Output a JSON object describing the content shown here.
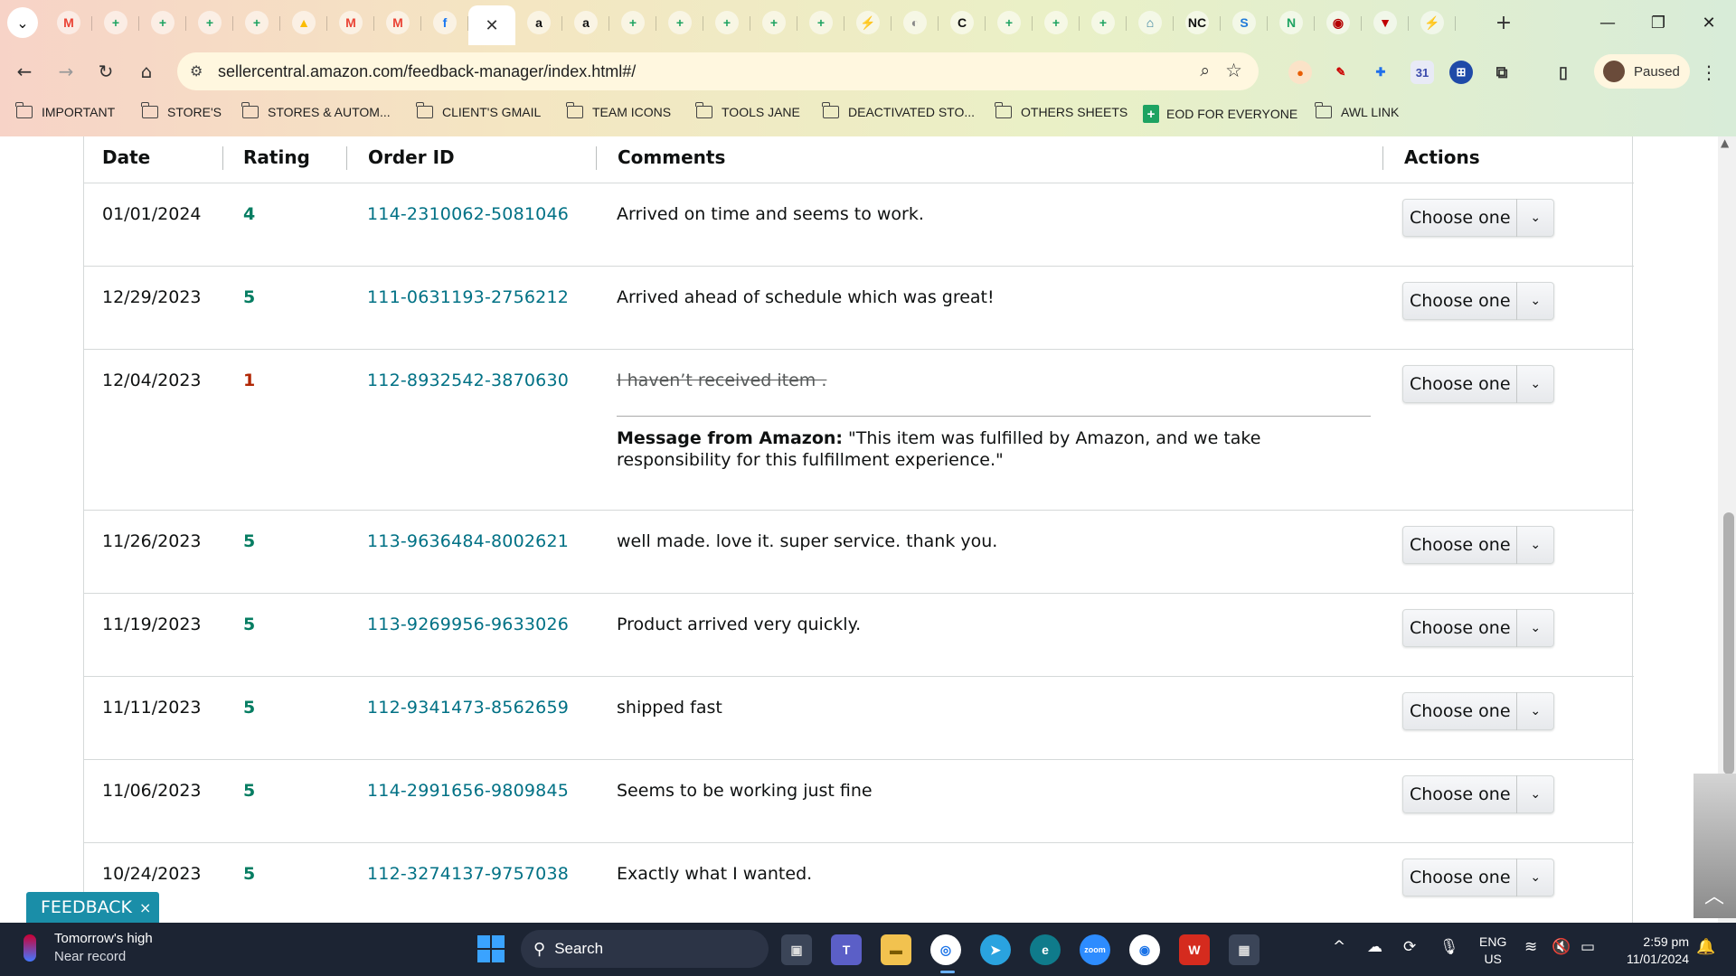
{
  "browser": {
    "url": "sellercentral.amazon.com/feedback-manager/index.html#/",
    "profile_label": "Paused",
    "tabs": [
      {
        "icon": "gmail-icon",
        "glyph": "M",
        "color": "#ea4335"
      },
      {
        "icon": "sheets-icon",
        "glyph": "+",
        "color": "#1ea362"
      },
      {
        "icon": "sheets-icon",
        "glyph": "+",
        "color": "#1ea362"
      },
      {
        "icon": "sheets-icon",
        "glyph": "+",
        "color": "#1ea362"
      },
      {
        "icon": "sheets-icon",
        "glyph": "+",
        "color": "#1ea362"
      },
      {
        "icon": "drive-icon",
        "glyph": "▲",
        "color": "#fbbc04"
      },
      {
        "icon": "gmail-icon",
        "glyph": "M",
        "color": "#ea4335"
      },
      {
        "icon": "gmail-icon",
        "glyph": "M",
        "color": "#ea4335"
      },
      {
        "icon": "facebook-icon",
        "glyph": "f",
        "color": "#1877f2"
      },
      {
        "icon": "close-icon",
        "glyph": "✕",
        "color": "#333333",
        "active": true
      },
      {
        "icon": "amazon-icon",
        "glyph": "a",
        "color": "#111111"
      },
      {
        "icon": "amazon-icon",
        "glyph": "a",
        "color": "#111111"
      },
      {
        "icon": "sheets-icon",
        "glyph": "+",
        "color": "#1ea362"
      },
      {
        "icon": "sheets-icon",
        "glyph": "+",
        "color": "#1ea362"
      },
      {
        "icon": "sheets-icon",
        "glyph": "+",
        "color": "#1ea362"
      },
      {
        "icon": "sheets-icon",
        "glyph": "+",
        "color": "#1ea362"
      },
      {
        "icon": "sheets-icon",
        "glyph": "+",
        "color": "#1ea362"
      },
      {
        "icon": "zapier-icon",
        "glyph": "⚡",
        "color": "#ff4f00"
      },
      {
        "icon": "globe-icon",
        "glyph": "◐",
        "color": "#888888"
      },
      {
        "icon": "c-icon",
        "glyph": "C",
        "color": "#111111"
      },
      {
        "icon": "sheets-icon",
        "glyph": "+",
        "color": "#1ea362"
      },
      {
        "icon": "sheets-icon",
        "glyph": "+",
        "color": "#1ea362"
      },
      {
        "icon": "sheets-icon",
        "glyph": "+",
        "color": "#1ea362"
      },
      {
        "icon": "tool-icon",
        "glyph": "⌂",
        "color": "#2a7a9a"
      },
      {
        "icon": "nc-icon",
        "glyph": "NC",
        "color": "#111111"
      },
      {
        "icon": "sysco-icon",
        "glyph": "S",
        "color": "#1f7ad9"
      },
      {
        "icon": "n-icon",
        "glyph": "N",
        "color": "#1ea362"
      },
      {
        "icon": "ext-icon",
        "glyph": "◉",
        "color": "#b40000"
      },
      {
        "icon": "shield-icon",
        "glyph": "▼",
        "color": "#c00000"
      },
      {
        "icon": "zapier-icon",
        "glyph": "⚡",
        "color": "#ff4f00"
      }
    ],
    "bookmarks": [
      {
        "label": "IMPORTANT",
        "kind": "folder"
      },
      {
        "label": "STORE'S",
        "kind": "folder"
      },
      {
        "label": "STORES & AUTOM...",
        "kind": "folder"
      },
      {
        "label": "CLIENT'S GMAIL",
        "kind": "folder"
      },
      {
        "label": "TEAM ICONS",
        "kind": "folder"
      },
      {
        "label": "TOOLS JANE",
        "kind": "folder"
      },
      {
        "label": "DEACTIVATED STO...",
        "kind": "folder"
      },
      {
        "label": "OTHERS SHEETS",
        "kind": "folder"
      },
      {
        "label": "EOD FOR EVERYONE",
        "kind": "sheet"
      },
      {
        "label": "AWL LINK",
        "kind": "folder"
      }
    ]
  },
  "table": {
    "headers": {
      "date": "Date",
      "rating": "Rating",
      "order_id": "Order ID",
      "comments": "Comments",
      "actions": "Actions"
    },
    "action_label": "Choose one",
    "rows": [
      {
        "date": "01/01/2024",
        "rating": "4",
        "order_id": "114-2310062-5081046",
        "comment": "Arrived on time and seems to work.",
        "struck": false
      },
      {
        "date": "12/29/2023",
        "rating": "5",
        "order_id": "111-0631193-2756212",
        "comment": "Arrived ahead of schedule which was great!",
        "struck": false
      },
      {
        "date": "12/04/2023",
        "rating": "1",
        "order_id": "112-8932542-3870630",
        "comment": "I haven’t received item .",
        "struck": true,
        "amazon_message_label": "Message from Amazon:",
        "amazon_message": " \"This item was fulfilled by Amazon, and we take responsibility for this fulfillment experience.\""
      },
      {
        "date": "11/26/2023",
        "rating": "5",
        "order_id": "113-9636484-8002621",
        "comment": "well made. love it. super service. thank you.",
        "struck": false
      },
      {
        "date": "11/19/2023",
        "rating": "5",
        "order_id": "113-9269956-9633026",
        "comment": "Product arrived very quickly.",
        "struck": false
      },
      {
        "date": "11/11/2023",
        "rating": "5",
        "order_id": "112-9341473-8562659",
        "comment": "shipped fast",
        "struck": false
      },
      {
        "date": "11/06/2023",
        "rating": "5",
        "order_id": "114-2991656-9809845",
        "comment": "Seems to be working just fine",
        "struck": false
      },
      {
        "date": "10/24/2023",
        "rating": "5",
        "order_id": "112-3274137-9757038",
        "comment": "Exactly what I wanted.",
        "struck": false
      }
    ]
  },
  "colors": {
    "rating_good": "#067d62",
    "rating_bad": "#b12704",
    "link": "#007185"
  },
  "feedback_tab": {
    "label": "FEEDBACK",
    "close": "×"
  },
  "taskbar": {
    "weather_line1": "Tomorrow's high",
    "weather_line2": "Near record",
    "search_placeholder": "Search",
    "lang_line1": "ENG",
    "lang_line2": "US",
    "time": "2:59 pm",
    "date": "11/01/2024"
  }
}
